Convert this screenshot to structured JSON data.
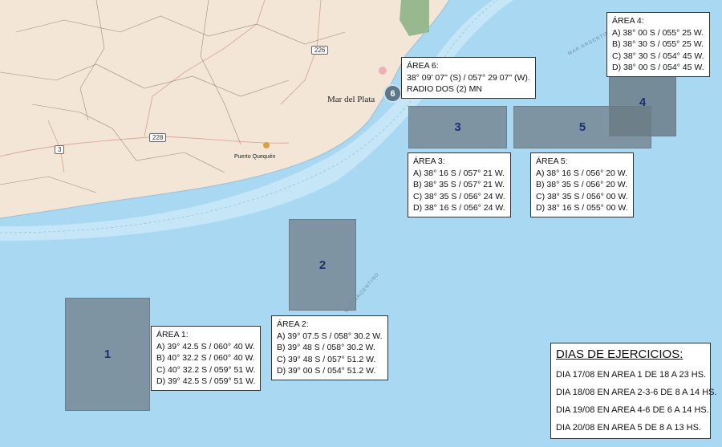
{
  "colors": {
    "sea": "#a9d8f2",
    "land": "#f3e6d6",
    "area_fill": "#7a8a96",
    "area_label": "#1b2f7a"
  },
  "map_labels": {
    "city": "Mar del Plata",
    "port": "Puerto Quequén",
    "sea_label_1": "MAR ARGENTINO",
    "sea_label_2": "MAR ARGENTINO"
  },
  "routes": [
    "226",
    "228",
    "3"
  ],
  "areas": [
    {
      "num": "1",
      "title": "ÁREA 1:",
      "coords": [
        "A) 39° 42.5 S / 060° 40 W.",
        "B) 40° 32.2 S / 060° 40 W.",
        "C) 40° 32.2 S / 059° 51 W.",
        "D) 39° 42.5 S / 059° 51 W."
      ]
    },
    {
      "num": "2",
      "title": "ÁREA 2:",
      "coords": [
        "A) 39° 07.5 S / 058° 30.2 W.",
        "B) 39° 48 S / 058° 30.2 W.",
        "C) 39° 48 S / 057° 51.2 W.",
        "D) 39° 00 S / 054° 51.2 W."
      ]
    },
    {
      "num": "3",
      "title": "ÁREA 3:",
      "coords": [
        "A) 38° 16 S / 057° 21 W.",
        "B) 38° 35 S / 057° 21 W.",
        "C) 38° 35 S / 056° 24 W.",
        "D) 38° 16 S / 056° 24 W."
      ]
    },
    {
      "num": "4",
      "title": "ÁREA 4:",
      "coords": [
        "A) 38° 00 S / 055° 25 W.",
        "B) 38° 30 S / 055° 25 W.",
        "C) 38° 30 S / 054° 45 W.",
        "D) 38° 00 S / 054° 45 W."
      ]
    },
    {
      "num": "5",
      "title": "ÁREA 5:",
      "coords": [
        "A) 38° 16 S / 056° 20 W.",
        "B) 38° 35 S / 056° 20 W.",
        "C) 38° 35 S / 056° 00 W.",
        "D) 38° 16 S / 055° 00 W."
      ]
    },
    {
      "num": "6",
      "title": "ÁREA 6:",
      "coords": [
        "38° 09' 07\" (S) / 057° 29 07\" (W).",
        "RADIO DOS (2) MN"
      ]
    }
  ],
  "schedule": {
    "title": "DIAS DE EJERCICIOS:",
    "rows": [
      "DIA 17/08 EN AREA 1 DE 18 A 23 HS.",
      "DIA 18/08 EN AREA 2-3-6 DE 8 A 14 HS.",
      "DIA 19/08 EN AREA 4-6 DE 6 A 14 HS.",
      "DIA 20/08 EN AREA 5 DE 8 A 13 HS."
    ]
  }
}
